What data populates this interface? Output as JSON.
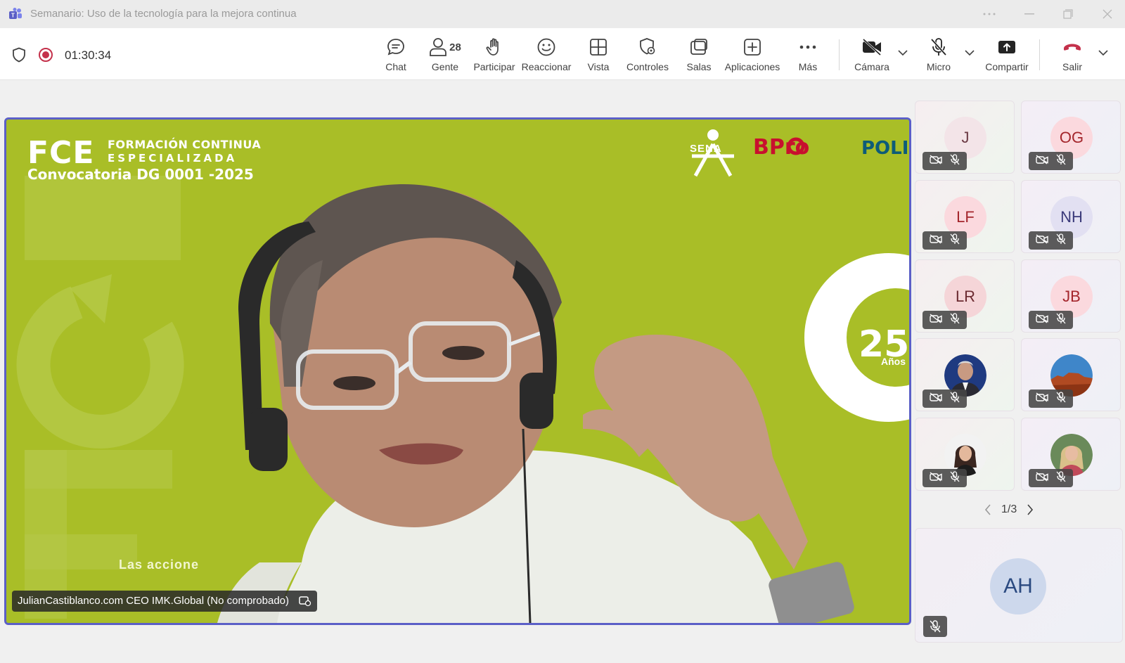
{
  "window": {
    "title": "Semanario: Uso de la tecnología para la mejora continua"
  },
  "toolbar": {
    "timer": "01:30:34",
    "people_count": "28",
    "buttons": {
      "chat": "Chat",
      "people": "Gente",
      "raise_hand": "Participar",
      "react": "Reaccionar",
      "view": "Vista",
      "controls": "Controles",
      "rooms": "Salas",
      "apps": "Aplicaciones",
      "more": "Más",
      "camera": "Cámara",
      "mic": "Micro",
      "share": "Compartir",
      "leave": "Salir"
    }
  },
  "main_video": {
    "speaker_name": "JulianCastiblanco.com CEO IMK.Global (No comprobado)",
    "banner": {
      "logo": "FCE",
      "line1": "FORMACIÓN CONTINUA",
      "line2": "ESPECIALIZADA",
      "line3": "Convocatoria DG 0001 -2025",
      "sena": "SENA",
      "bpro": "BPro",
      "poli": "POLI",
      "anniversary_number": "25",
      "anniversary_word": "Años",
      "bottom_text": "Las accione"
    }
  },
  "participants": [
    {
      "initials": "J",
      "bg": "#f3e4e8",
      "fg": "#6b3a44"
    },
    {
      "initials": "OG",
      "bg": "#fbd9de",
      "fg": "#a4262c"
    },
    {
      "initials": "LF",
      "bg": "#fbd9de",
      "fg": "#a4262c"
    },
    {
      "initials": "NH",
      "bg": "#e2e0f2",
      "fg": "#3b3a7a"
    },
    {
      "initials": "LR",
      "bg": "#f5d5d8",
      "fg": "#6b2a30"
    },
    {
      "initials": "JB",
      "bg": "#fbd9de",
      "fg": "#a4262c"
    },
    {
      "initials": "",
      "photo": "man-suit"
    },
    {
      "initials": "",
      "photo": "desert-landscape"
    },
    {
      "initials": "",
      "photo": "woman-dark-hair"
    },
    {
      "initials": "",
      "photo": "woman-blonde"
    }
  ],
  "pager": {
    "label": "1/3"
  },
  "self_tile": {
    "initials": "AH"
  },
  "colors": {
    "accent": "#5b5fc7",
    "record": "#c4314b",
    "leave": "#c4314b",
    "banner_green": "#a9be27"
  }
}
